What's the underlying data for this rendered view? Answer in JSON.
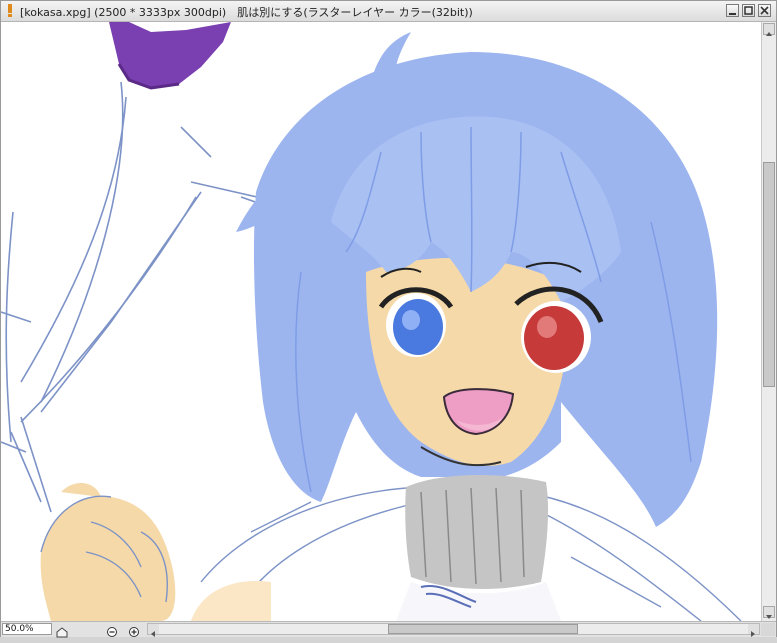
{
  "window": {
    "title": "[kokasa.xpg] (2500 * 3333px 300dpi)　肌は別にする(ラスターレイヤー カラー(32bit))"
  },
  "status": {
    "zoom": "50.0%"
  },
  "icons": {
    "app": "app-icon",
    "minimize": "minimize-icon",
    "maximize": "maximize-icon",
    "close": "close-icon",
    "home": "home-icon",
    "zoom_out": "zoom-out-icon",
    "zoom_in": "zoom-in-icon"
  },
  "colors": {
    "hair": "#9db5ef",
    "skin": "#f5d9a8",
    "eye_left": "#4a7ae0",
    "eye_right": "#c73a3a",
    "bow": "#7a3fb0",
    "line_sketch": "#7d93c7"
  }
}
